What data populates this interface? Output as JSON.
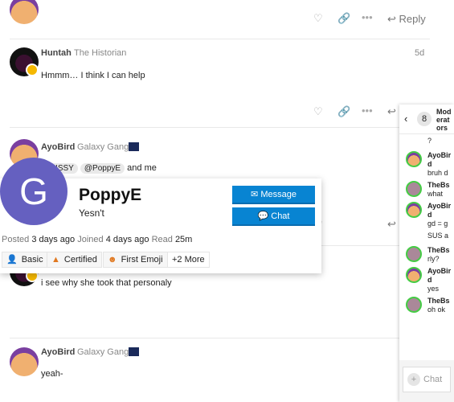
{
  "top_post": {
    "reply_label": "Reply"
  },
  "posts": [
    {
      "username": "Huntah",
      "user_title": "The Historian",
      "age": "5d",
      "text": "Hmmm… I think I can help"
    },
    {
      "username": "AyoBird",
      "user_title": "Galaxy Gang",
      "mention1": "@KRISSY",
      "mention2": "@PoppyE",
      "text_after": "and me"
    },
    {
      "text": "i see why she took that personaly"
    },
    {
      "username": "AyoBird",
      "user_title": "Galaxy Gang",
      "text": "yeah-"
    }
  ],
  "user_card": {
    "avatar_letter": "G",
    "avatar_color": "#6560c0",
    "username": "PoppyE",
    "bio": "Yesn't",
    "message_label": "Message",
    "chat_label": "Chat",
    "posted_label": "Posted",
    "posted_value": "3 days ago",
    "joined_label": "Joined",
    "joined_value": "4 days ago",
    "read_label": "Read",
    "read_value": "25m",
    "badges": [
      "Basic",
      "Certified",
      "First Emoji",
      "+2 More"
    ]
  },
  "chat": {
    "count": "8",
    "channel": "Moderators",
    "input_placeholder": "Chat",
    "messages": [
      {
        "text": "?"
      },
      {
        "user": "AyoBird",
        "text": "bruh d"
      },
      {
        "user": "TheBs",
        "text": "what"
      },
      {
        "user": "AyoBird",
        "text": "gd = g"
      },
      {
        "text": "SUS a"
      },
      {
        "user": "TheBs",
        "text": "rly?"
      },
      {
        "user": "AyoBird",
        "text": "yes"
      },
      {
        "user": "TheBs",
        "text": "oh ok"
      }
    ]
  },
  "accent": "#0884d2"
}
